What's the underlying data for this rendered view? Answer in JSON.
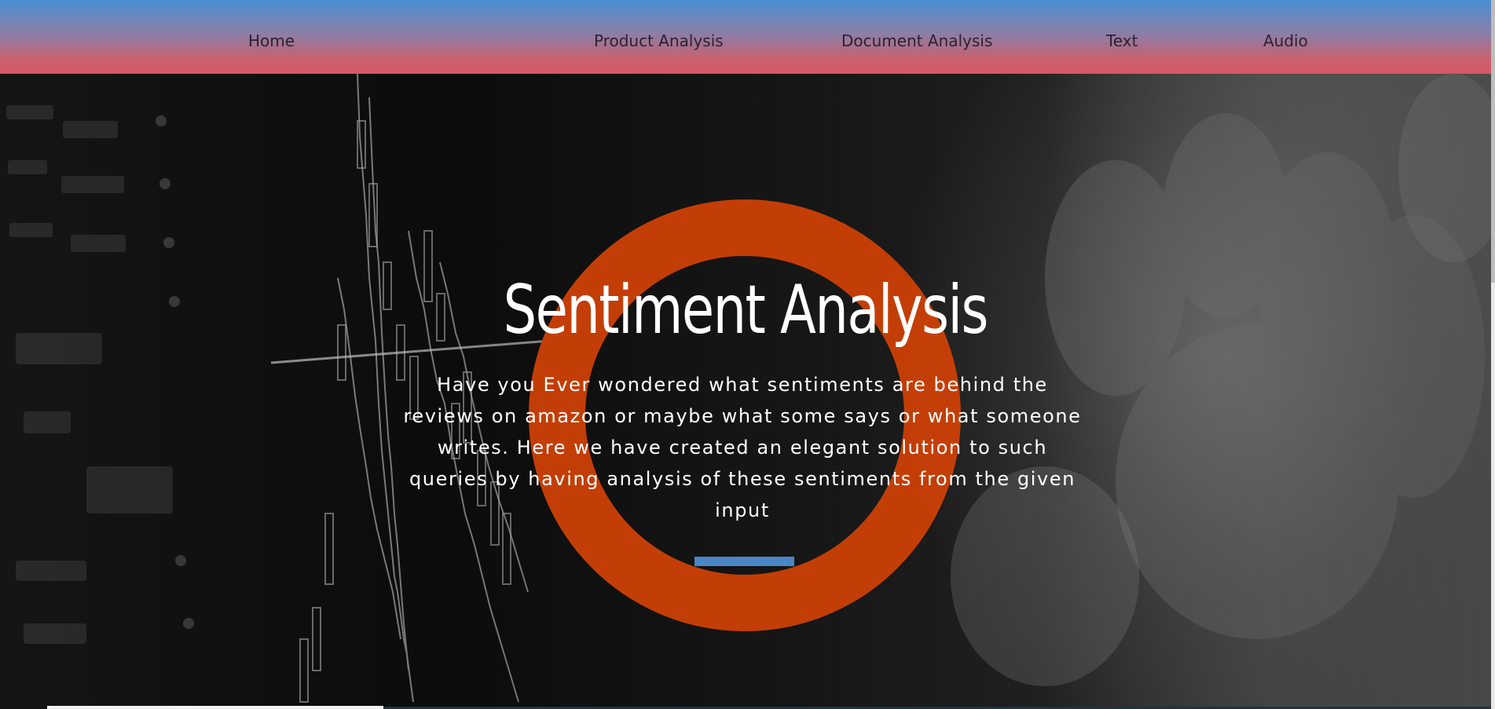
{
  "nav": {
    "items": [
      {
        "label": "Home"
      },
      {
        "label": "Product Analysis"
      },
      {
        "label": "Document Analysis"
      },
      {
        "label": "Text"
      },
      {
        "label": "Audio"
      }
    ]
  },
  "hero": {
    "title": "Sentiment Analysis",
    "description": "Have you Ever wondered what sentiments are behind the reviews on amazon or maybe what some says or what someone writes. Here we have created an elegant solution to such queries by having analysis of these sentiments from the given input"
  },
  "colors": {
    "nav_top": "#4a8fd3",
    "nav_bottom": "#d55766",
    "ring": "#c94006",
    "accent_bar": "#4a86c5",
    "nav_text": "#2a2233",
    "hero_text": "#ffffff"
  }
}
